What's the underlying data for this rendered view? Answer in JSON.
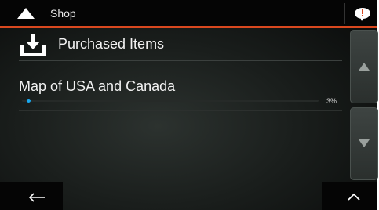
{
  "header": {
    "title": "Shop",
    "back_icon": "triangle-up-icon",
    "message_icon": "chat-bubble-icon"
  },
  "accent_color": "#d9481f",
  "section": {
    "label": "Purchased Items",
    "icon": "download-tray-icon"
  },
  "items": [
    {
      "name": "Map of USA and Canada",
      "progress_label": "3%",
      "progress": 0.03,
      "progress_color": "#19a9f0"
    }
  ],
  "scroll": {
    "up_icon": "triangle-up-icon",
    "down_icon": "triangle-down-icon"
  },
  "footer": {
    "back_icon": "arrow-left-icon",
    "menu_icon": "chevron-up-icon"
  }
}
